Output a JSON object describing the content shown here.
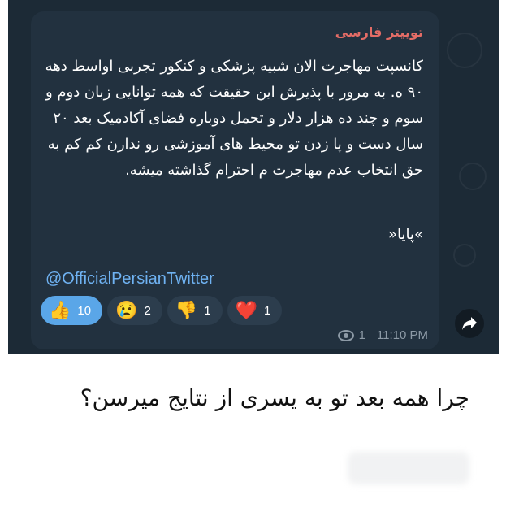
{
  "post": {
    "channel_name": "توییتر فارسی",
    "message_text": "کانسپت مهاجرت الان شبیه پزشکی و کنکور تجربی اواسط دهه ۹۰ ه. به مرور با پذیرش این حقیقت که همه توانایی زبان دوم و سوم و چند ده هزار دلار و تحمل دوباره فضای آکادمیک بعد ۲۰ سال دست و پا زدن تو محیط های آموزشی رو ندارن کم کم به حق انتخاب عدم مهاجرت م احترام گذاشته میشه.",
    "signature": "»پایا«",
    "handle": "@OfficialPersianTwitter",
    "reactions": [
      {
        "icon": "thumbs-up-icon",
        "glyph": "👍",
        "count": "10",
        "active": true
      },
      {
        "icon": "crying-face-icon",
        "glyph": "😢",
        "count": "2",
        "active": false
      },
      {
        "icon": "thumbs-down-icon",
        "glyph": "👎",
        "count": "1",
        "active": false
      },
      {
        "icon": "heart-icon",
        "glyph": "❤️",
        "count": "1",
        "active": false
      }
    ],
    "views": "1",
    "time": "11:10 PM"
  },
  "tweet": {
    "text": "چرا همه بعد تو به یسری از نتایج میرسن؟"
  },
  "colors": {
    "chat_bg": "#1c2a36",
    "bubble": "#22313f",
    "channel_name": "#e46c66",
    "link": "#6fb2f2",
    "active_reaction": "#5aa6e8"
  }
}
